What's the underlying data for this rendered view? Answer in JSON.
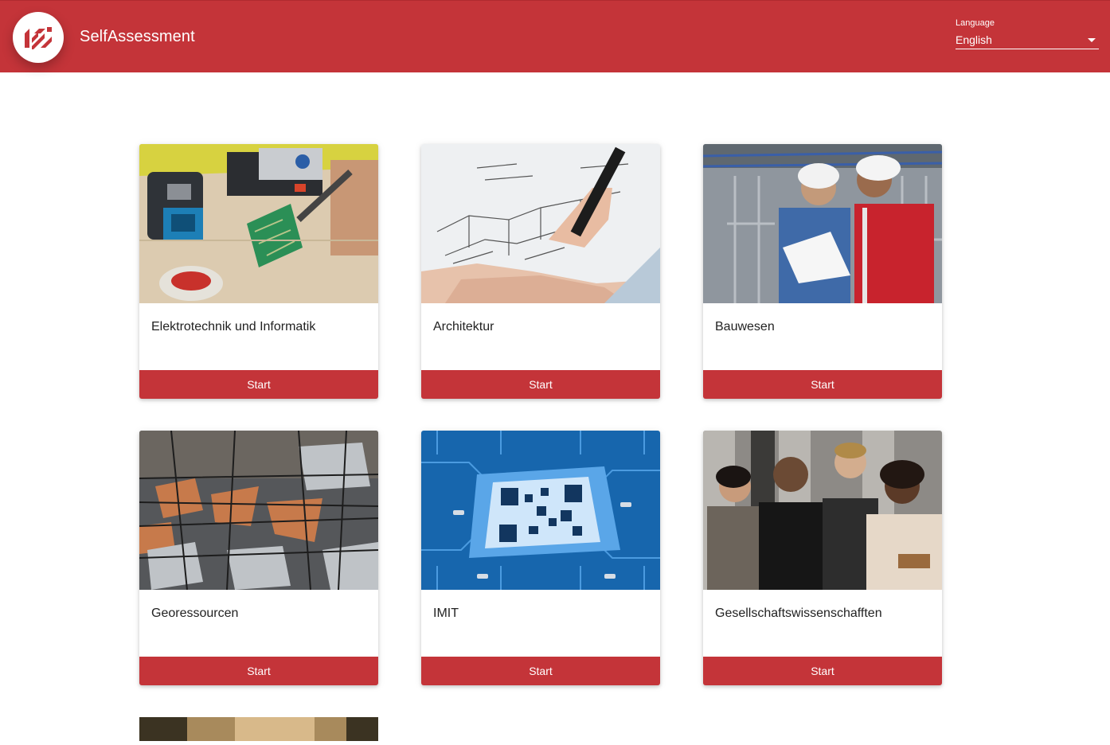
{
  "header": {
    "app_title": "SelfAssessment",
    "language_label": "Language",
    "language_value": "English"
  },
  "cards": [
    {
      "title": "Elektrotechnik und Informatik",
      "button": "Start"
    },
    {
      "title": "Architektur",
      "button": "Start"
    },
    {
      "title": "Bauwesen",
      "button": "Start"
    },
    {
      "title": "Georessourcen",
      "button": "Start"
    },
    {
      "title": "IMIT",
      "button": "Start"
    },
    {
      "title": "Gesellschaftswissenschafften",
      "button": "Start"
    }
  ],
  "colors": {
    "brand": "#c43439",
    "text": "#222222",
    "background": "#ffffff"
  },
  "icons": {
    "logo": "university-logo-icon",
    "dropdown": "chevron-down-icon"
  }
}
